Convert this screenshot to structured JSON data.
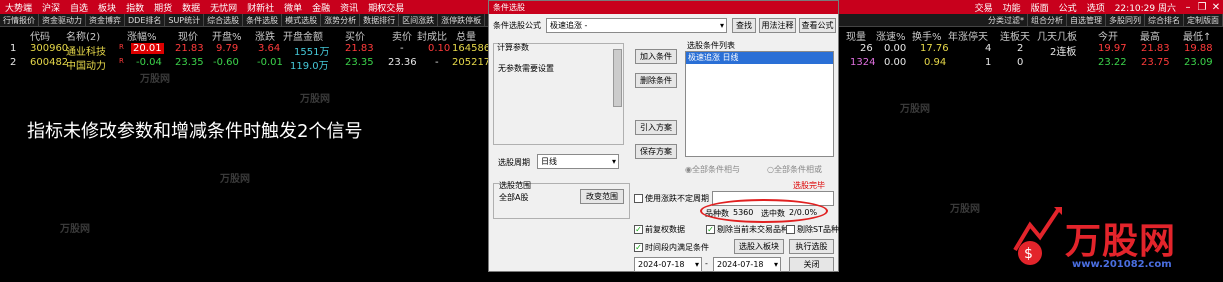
{
  "menubar": {
    "items": [
      "大势端",
      "沪深",
      "自选",
      "板块",
      "指数",
      "期货",
      "数据",
      "无忧网",
      "财新社",
      "微单",
      "金融",
      "资讯",
      "期权交易"
    ],
    "right_items": [
      "交易",
      "功能",
      "版面",
      "公式",
      "选项",
      "22:10:29 周六"
    ]
  },
  "toolbar": {
    "items": [
      "行情报价",
      "资金驱动力",
      "资金博弈",
      "DDE排名",
      "SUP统计",
      "综合选股",
      "条件选股",
      "模式选股",
      "涨势分析",
      "数据排行",
      "区间涨跌",
      "涨停跌停板",
      "跌停板",
      "热门"
    ],
    "right_items": [
      "分类过滤*",
      "组合分析",
      "自选管理",
      "多股同列",
      "综合排名",
      "定制版面"
    ]
  },
  "table": {
    "headers": [
      "代码",
      "名称(2)",
      "涨幅%",
      "现价",
      "开盘%",
      "涨跌",
      "开盘金额",
      "买价",
      "卖价",
      "封成比",
      "总量",
      "现量",
      "涨速%",
      "换手%",
      "年涨停天",
      "连板天",
      "几天几板",
      "今开",
      "最高",
      "最低↑"
    ],
    "rows": [
      {
        "idx": "1",
        "code": "300960",
        "name": "通业科技",
        "pct": "20.01",
        "price": "21.83",
        "open_pct": "9.79",
        "chg": "3.64",
        "amt": "1551万",
        "bid": "21.83",
        "ask": "-",
        "ratio": "0.10",
        "vol": "164586",
        "cur": "26",
        "speed": "0.00",
        "turn": "17.76",
        "yr": "4",
        "lian": "2",
        "jt": "2连板",
        "open": "19.97",
        "high": "21.83",
        "low": "19.88"
      },
      {
        "idx": "2",
        "code": "600482",
        "name": "中国动力",
        "pct": "-0.04",
        "price": "23.35",
        "open_pct": "-0.60",
        "chg": "-0.01",
        "amt": "119.0万",
        "bid": "23.35",
        "ask": "23.36",
        "ratio": "-",
        "vol": "205217",
        "cur": "1324",
        "speed": "0.00",
        "turn": "0.94",
        "yr": "1",
        "lian": "0",
        "jt": "",
        "open": "23.22",
        "high": "23.75",
        "low": "23.09"
      }
    ]
  },
  "annotation": "指标未修改参数和增减条件时触发2个信号",
  "dialog": {
    "title": "条件选股",
    "formula_label": "条件选股公式",
    "formula_value": "极速追涨 -",
    "btn_find": "查找",
    "btn_usage": "用法注释",
    "btn_view": "查看公式",
    "calc_params_label": "计算参数",
    "no_params_text": "无参数需要设置",
    "btn_add": "加入条件",
    "btn_delete": "删除条件",
    "btn_import": "引入方案",
    "btn_save": "保存方案",
    "conditions_label": "选股条件列表",
    "condition_item": "极速追涨 日线",
    "period_label": "选股周期",
    "period_value": "日线",
    "radio_all": "全部条件相与",
    "radio_any": "全部条件相或",
    "range_label": "选股范围",
    "range_value": "全部A股",
    "btn_change_range": "改变范围",
    "cb_unfixed": "使用涨跌不定周期",
    "link_calc": "选股完毕",
    "count_label": "品种数",
    "count_value": "5360",
    "selected_label": "选中数",
    "selected_value": "2/0.0%",
    "cb_prev_data": "前复权数据",
    "cb_remove_untraded": "剔除当前未交易品种",
    "cb_remove_st": "剔除ST品种",
    "cb_time_range": "时间段内满足条件",
    "btn_to_block": "选股入板块",
    "btn_execute": "执行选股",
    "date_from": "2024-07-18",
    "date_to": "2024-07-18",
    "btn_close": "关闭"
  },
  "logo": {
    "name": "万股网",
    "url": "www.201082.com"
  },
  "watermark": "万股网"
}
